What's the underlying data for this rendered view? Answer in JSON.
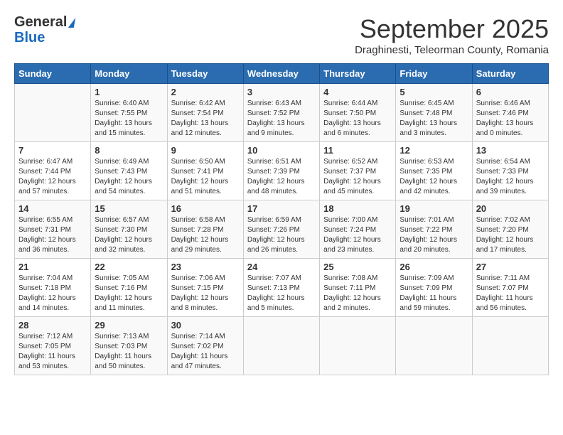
{
  "logo": {
    "line1": "General",
    "line2": "Blue"
  },
  "title": "September 2025",
  "subtitle": "Draghinesti, Teleorman County, Romania",
  "weekdays": [
    "Sunday",
    "Monday",
    "Tuesday",
    "Wednesday",
    "Thursday",
    "Friday",
    "Saturday"
  ],
  "weeks": [
    [
      {
        "day": "",
        "info": ""
      },
      {
        "day": "1",
        "info": "Sunrise: 6:40 AM\nSunset: 7:55 PM\nDaylight: 13 hours\nand 15 minutes."
      },
      {
        "day": "2",
        "info": "Sunrise: 6:42 AM\nSunset: 7:54 PM\nDaylight: 13 hours\nand 12 minutes."
      },
      {
        "day": "3",
        "info": "Sunrise: 6:43 AM\nSunset: 7:52 PM\nDaylight: 13 hours\nand 9 minutes."
      },
      {
        "day": "4",
        "info": "Sunrise: 6:44 AM\nSunset: 7:50 PM\nDaylight: 13 hours\nand 6 minutes."
      },
      {
        "day": "5",
        "info": "Sunrise: 6:45 AM\nSunset: 7:48 PM\nDaylight: 13 hours\nand 3 minutes."
      },
      {
        "day": "6",
        "info": "Sunrise: 6:46 AM\nSunset: 7:46 PM\nDaylight: 13 hours\nand 0 minutes."
      }
    ],
    [
      {
        "day": "7",
        "info": "Sunrise: 6:47 AM\nSunset: 7:44 PM\nDaylight: 12 hours\nand 57 minutes."
      },
      {
        "day": "8",
        "info": "Sunrise: 6:49 AM\nSunset: 7:43 PM\nDaylight: 12 hours\nand 54 minutes."
      },
      {
        "day": "9",
        "info": "Sunrise: 6:50 AM\nSunset: 7:41 PM\nDaylight: 12 hours\nand 51 minutes."
      },
      {
        "day": "10",
        "info": "Sunrise: 6:51 AM\nSunset: 7:39 PM\nDaylight: 12 hours\nand 48 minutes."
      },
      {
        "day": "11",
        "info": "Sunrise: 6:52 AM\nSunset: 7:37 PM\nDaylight: 12 hours\nand 45 minutes."
      },
      {
        "day": "12",
        "info": "Sunrise: 6:53 AM\nSunset: 7:35 PM\nDaylight: 12 hours\nand 42 minutes."
      },
      {
        "day": "13",
        "info": "Sunrise: 6:54 AM\nSunset: 7:33 PM\nDaylight: 12 hours\nand 39 minutes."
      }
    ],
    [
      {
        "day": "14",
        "info": "Sunrise: 6:55 AM\nSunset: 7:31 PM\nDaylight: 12 hours\nand 36 minutes."
      },
      {
        "day": "15",
        "info": "Sunrise: 6:57 AM\nSunset: 7:30 PM\nDaylight: 12 hours\nand 32 minutes."
      },
      {
        "day": "16",
        "info": "Sunrise: 6:58 AM\nSunset: 7:28 PM\nDaylight: 12 hours\nand 29 minutes."
      },
      {
        "day": "17",
        "info": "Sunrise: 6:59 AM\nSunset: 7:26 PM\nDaylight: 12 hours\nand 26 minutes."
      },
      {
        "day": "18",
        "info": "Sunrise: 7:00 AM\nSunset: 7:24 PM\nDaylight: 12 hours\nand 23 minutes."
      },
      {
        "day": "19",
        "info": "Sunrise: 7:01 AM\nSunset: 7:22 PM\nDaylight: 12 hours\nand 20 minutes."
      },
      {
        "day": "20",
        "info": "Sunrise: 7:02 AM\nSunset: 7:20 PM\nDaylight: 12 hours\nand 17 minutes."
      }
    ],
    [
      {
        "day": "21",
        "info": "Sunrise: 7:04 AM\nSunset: 7:18 PM\nDaylight: 12 hours\nand 14 minutes."
      },
      {
        "day": "22",
        "info": "Sunrise: 7:05 AM\nSunset: 7:16 PM\nDaylight: 12 hours\nand 11 minutes."
      },
      {
        "day": "23",
        "info": "Sunrise: 7:06 AM\nSunset: 7:15 PM\nDaylight: 12 hours\nand 8 minutes."
      },
      {
        "day": "24",
        "info": "Sunrise: 7:07 AM\nSunset: 7:13 PM\nDaylight: 12 hours\nand 5 minutes."
      },
      {
        "day": "25",
        "info": "Sunrise: 7:08 AM\nSunset: 7:11 PM\nDaylight: 12 hours\nand 2 minutes."
      },
      {
        "day": "26",
        "info": "Sunrise: 7:09 AM\nSunset: 7:09 PM\nDaylight: 11 hours\nand 59 minutes."
      },
      {
        "day": "27",
        "info": "Sunrise: 7:11 AM\nSunset: 7:07 PM\nDaylight: 11 hours\nand 56 minutes."
      }
    ],
    [
      {
        "day": "28",
        "info": "Sunrise: 7:12 AM\nSunset: 7:05 PM\nDaylight: 11 hours\nand 53 minutes."
      },
      {
        "day": "29",
        "info": "Sunrise: 7:13 AM\nSunset: 7:03 PM\nDaylight: 11 hours\nand 50 minutes."
      },
      {
        "day": "30",
        "info": "Sunrise: 7:14 AM\nSunset: 7:02 PM\nDaylight: 11 hours\nand 47 minutes."
      },
      {
        "day": "",
        "info": ""
      },
      {
        "day": "",
        "info": ""
      },
      {
        "day": "",
        "info": ""
      },
      {
        "day": "",
        "info": ""
      }
    ]
  ]
}
